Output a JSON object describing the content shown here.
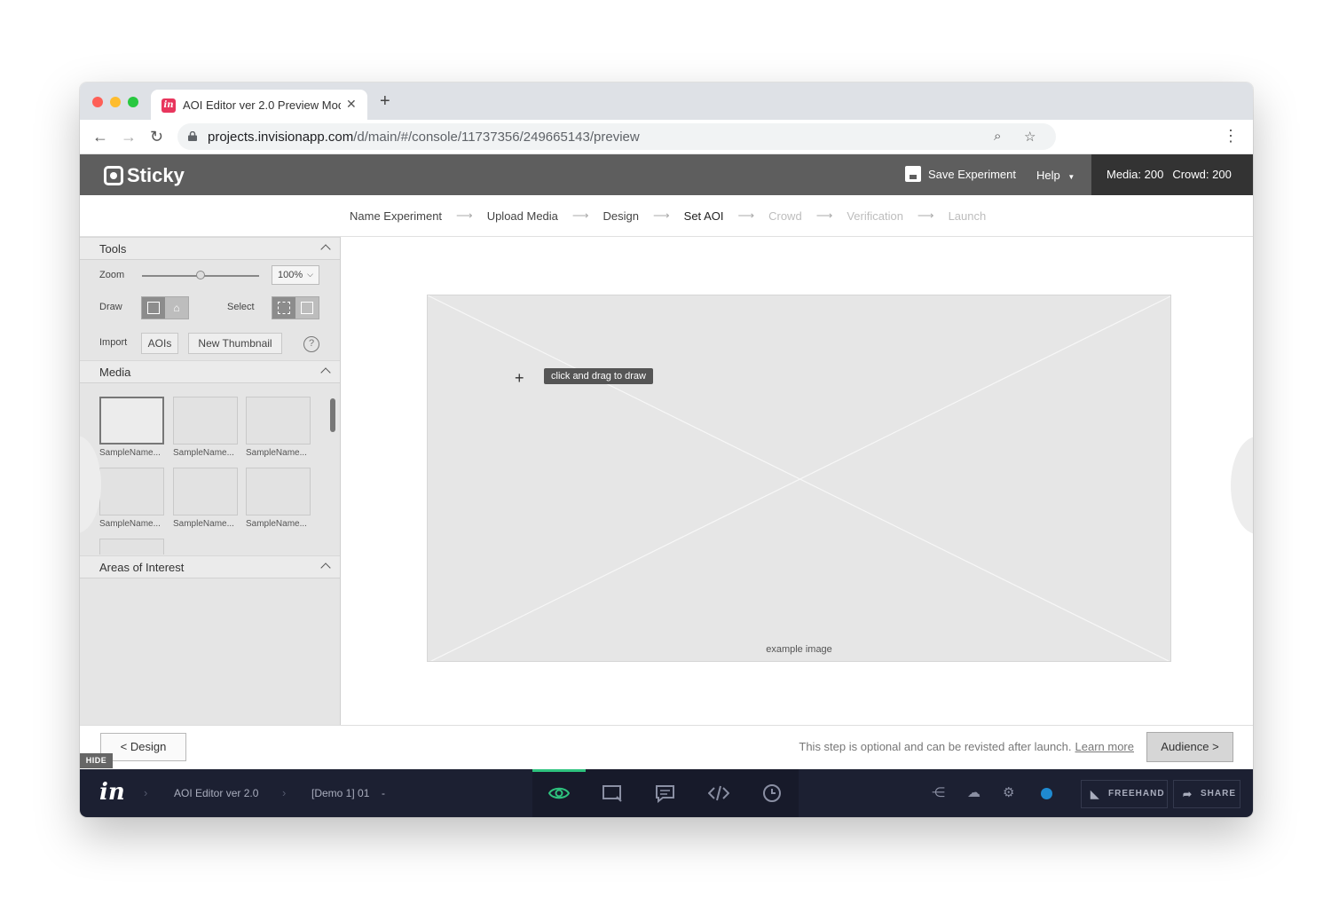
{
  "browser": {
    "tab_title": "AOI Editor ver 2.0 Preview Mod",
    "tab_close": "✕",
    "new_tab": "+",
    "url_host": "projects.invisionapp.com",
    "url_path": "/d/main/#/console/11737356/249665143/preview"
  },
  "app": {
    "logo": "Sticky",
    "save_label": "Save Experiment",
    "help_label": "Help",
    "media_count": "Media: 200",
    "crowd_count": "Crowd: 200"
  },
  "steps": [
    {
      "label": "Name  Experiment",
      "state": "done"
    },
    {
      "label": "Upload Media",
      "state": "done"
    },
    {
      "label": "Design",
      "state": "done"
    },
    {
      "label": "Set AOI",
      "state": "current"
    },
    {
      "label": "Crowd",
      "state": "disabled"
    },
    {
      "label": "Verification",
      "state": "disabled"
    },
    {
      "label": "Launch",
      "state": "disabled"
    }
  ],
  "tools": {
    "title": "Tools",
    "zoom_label": "Zoom",
    "zoom_value": "100%",
    "zoom_fraction": 0.5,
    "draw_label": "Draw",
    "select_label": "Select",
    "import_label": "Import",
    "aois_button": "AOIs",
    "thumbnail_button": "New Thumbnail",
    "help": "?"
  },
  "media": {
    "title": "Media",
    "items": [
      "SampleName...",
      "SampleName...",
      "SampleName...",
      "SampleName...",
      "SampleName...",
      "SampleName..."
    ]
  },
  "aoi_panel": {
    "title": "Areas of Interest"
  },
  "canvas": {
    "tooltip": "click and drag to draw",
    "caption": "example image"
  },
  "footer": {
    "back_button": "<  Design",
    "note": "This step is optional and can be revisted after launch.",
    "learn_more": "Learn more",
    "next_button": "Audience  >",
    "hide_tag": "HIDE"
  },
  "invision": {
    "logo": "in",
    "crumb_project": "AOI Editor ver 2.0",
    "crumb_screen": "[Demo 1] 01",
    "crumb_caret": "-",
    "freehand": "FREEHAND",
    "share": "SHARE"
  },
  "colors": {
    "app_header": "#5e5e5e",
    "invision_bar": "#1c2032",
    "active_tool": "#2ec27e",
    "status_dot": "#1f8ad1"
  }
}
